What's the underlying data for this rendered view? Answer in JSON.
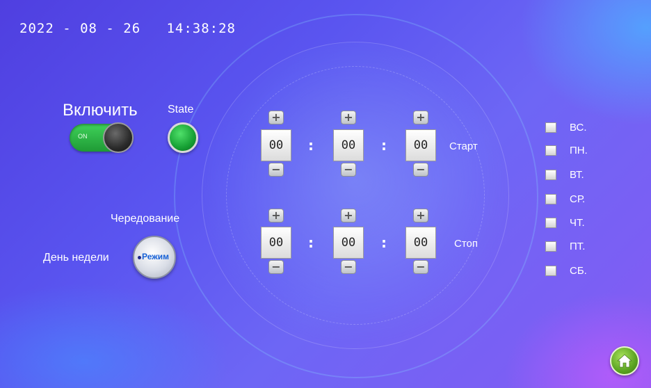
{
  "status_bar": {
    "date": "2022-08-26",
    "time": "14:38:28",
    "datetime": "2022 - 08 - 26   14:38:28"
  },
  "enable": {
    "label": "Включить",
    "switch_text": "ON",
    "is_on": true,
    "color": "#2fbf4a"
  },
  "state": {
    "label": "State",
    "color": "#1fae3f"
  },
  "mode": {
    "top_label": "Чередование",
    "left_label": "День недели",
    "button_label": "Режим"
  },
  "start": {
    "label": "Старт",
    "hours": "00",
    "minutes": "00",
    "seconds": "00"
  },
  "stop": {
    "label": "Стоп",
    "hours": "00",
    "minutes": "00",
    "seconds": "00"
  },
  "stepper": {
    "plus": "+",
    "minus": "−",
    "colon": ":"
  },
  "days": [
    {
      "label": "ВС.",
      "checked": false
    },
    {
      "label": "ПН.",
      "checked": false
    },
    {
      "label": "ВТ.",
      "checked": false
    },
    {
      "label": "СР.",
      "checked": false
    },
    {
      "label": "ЧТ.",
      "checked": false
    },
    {
      "label": "ПТ.",
      "checked": false
    },
    {
      "label": "СБ.",
      "checked": false
    }
  ],
  "home": {
    "icon": "home-icon"
  }
}
